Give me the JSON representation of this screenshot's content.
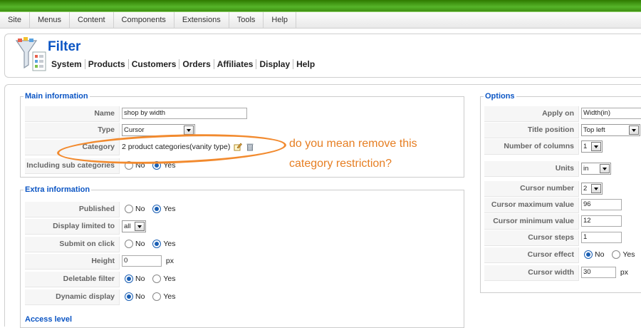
{
  "menubar": {
    "items": [
      "Site",
      "Menus",
      "Content",
      "Components",
      "Extensions",
      "Tools",
      "Help"
    ]
  },
  "header": {
    "title": "Filter",
    "submenu": [
      "System",
      "Products",
      "Customers",
      "Orders",
      "Affiliates",
      "Display",
      "Help"
    ]
  },
  "main": {
    "legend": "Main information",
    "name_label": "Name",
    "name_value": "shop by width",
    "type_label": "Type",
    "type_value": "Cursor",
    "category_label": "Category",
    "category_value": "2 product categories(vanity type)",
    "subcat_label": "Including sub categories",
    "no": "No",
    "yes": "Yes"
  },
  "extra": {
    "legend": "Extra information",
    "published_label": "Published",
    "display_limited_label": "Display limited to",
    "display_limited_value": "all",
    "submit_label": "Submit on click",
    "height_label": "Height",
    "height_value": "0",
    "height_unit": "px",
    "deletable_label": "Deletable filter",
    "dynamic_label": "Dynamic display",
    "access_legend": "Access level"
  },
  "options": {
    "legend": "Options",
    "apply_on_label": "Apply on",
    "apply_on_value": "Width(in)",
    "title_position_label": "Title position",
    "title_position_value": "Top left",
    "columns_label": "Number of columns",
    "columns_value": "1",
    "units_label": "Units",
    "units_value": "in",
    "cursor_number_label": "Cursor number",
    "cursor_number_value": "2",
    "cursor_max_label": "Cursor maximum value",
    "cursor_max_value": "96",
    "cursor_min_label": "Cursor minimum value",
    "cursor_min_value": "12",
    "cursor_steps_label": "Cursor steps",
    "cursor_steps_value": "1",
    "cursor_effect_label": "Cursor effect",
    "cursor_width_label": "Cursor width",
    "cursor_width_value": "30",
    "cursor_width_unit": "px"
  },
  "annotation": {
    "text": "do you mean remove this category restriction?",
    "color": "#e67e22"
  },
  "colors": {
    "topbar": "#3d8f10",
    "title": "#0b55c4",
    "legend": "#0b55c4"
  },
  "icons": [
    "filter-logo-icon",
    "edit-category-icon",
    "delete-category-icon",
    "dropdown-arrow-icon"
  ]
}
